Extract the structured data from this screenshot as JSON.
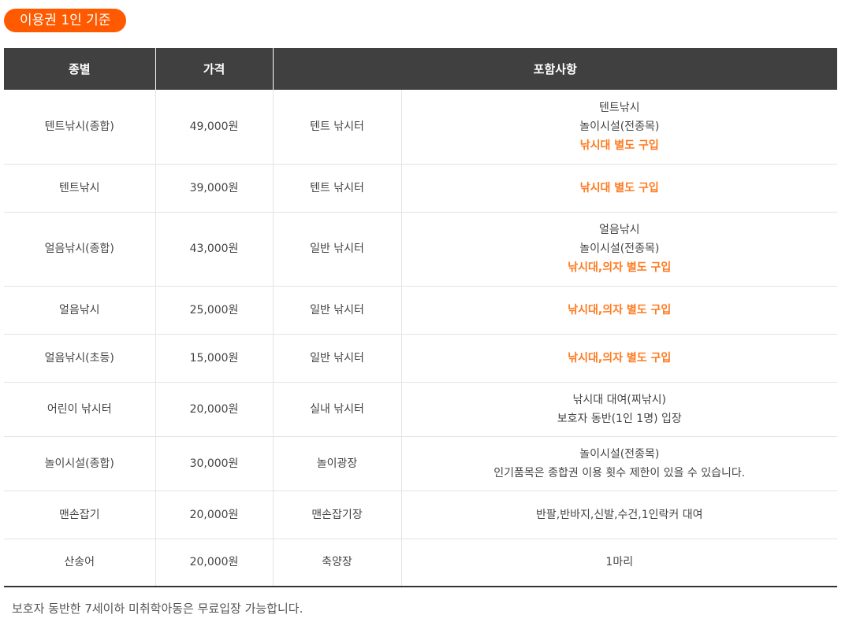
{
  "badge": "이용권 1인 기준",
  "table": {
    "headers": [
      "종별",
      "가격",
      "포함사항"
    ],
    "rows": [
      {
        "type": "텐트낚시(종합)",
        "price": "49,000원",
        "place": "텐트 낚시터",
        "includes": [
          "텐트낚시",
          "놀이시설(전종목)"
        ],
        "highlight": "낚시대 별도 구입"
      },
      {
        "type": "텐트낚시",
        "price": "39,000원",
        "place": "텐트 낚시터",
        "includes": [],
        "highlight": "낚시대 별도 구입"
      },
      {
        "type": "얼음낚시(종합)",
        "price": "43,000원",
        "place": "일반 낚시터",
        "includes": [
          "얼음낚시",
          "놀이시설(전종목)"
        ],
        "highlight": "낚시대,의자 별도 구입"
      },
      {
        "type": "얼음낚시",
        "price": "25,000원",
        "place": "일반 낚시터",
        "includes": [],
        "highlight": "낚시대,의자 별도 구입"
      },
      {
        "type": "얼음낚시(초등)",
        "price": "15,000원",
        "place": "일반 낚시터",
        "includes": [],
        "highlight": "낚시대,의자 별도 구입"
      },
      {
        "type": "어린이 낚시터",
        "price": "20,000원",
        "place": "실내 낚시터",
        "includes": [
          "낚시대 대여(찌낚시)",
          "보호자 동반(1인 1명) 입장"
        ],
        "highlight": ""
      },
      {
        "type": "놀이시설(종합)",
        "price": "30,000원",
        "place": "놀이광장",
        "includes": [
          "놀이시설(전종목)",
          "인기품목은 종합권 이용 횟수 제한이 있을 수 있습니다."
        ],
        "highlight": ""
      },
      {
        "type": "맨손잡기",
        "price": "20,000원",
        "place": "맨손잡기장",
        "includes": [
          "반팔,반바지,신발,수건,1인락커 대여"
        ],
        "highlight": ""
      },
      {
        "type": "산송어",
        "price": "20,000원",
        "place": "축양장",
        "includes": [
          "1마리"
        ],
        "highlight": ""
      }
    ]
  },
  "note": "보호자 동반한 7세이하 미취학아동은 무료입장 가능합니다.",
  "colors": {
    "accent": "#ff5a00",
    "highlight": "#ff7a1f",
    "header_bg": "#404040"
  }
}
